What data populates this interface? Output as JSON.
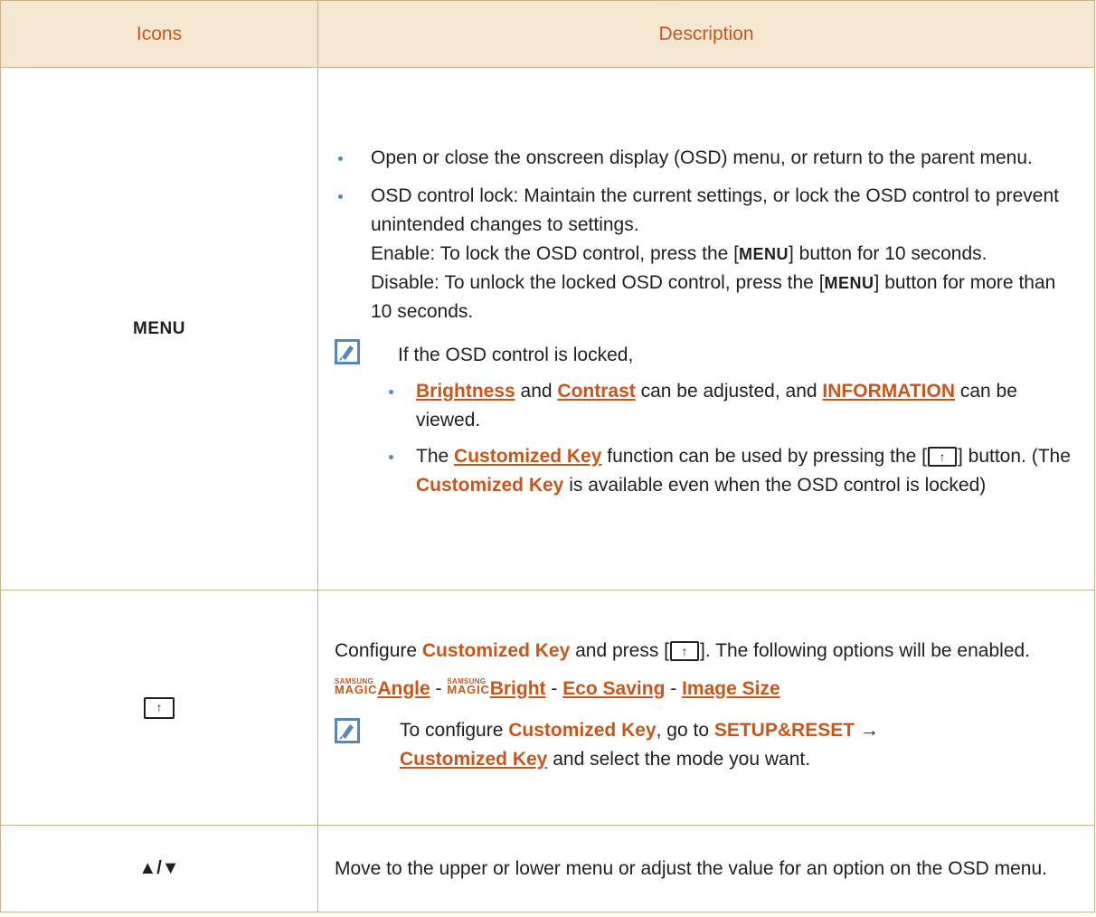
{
  "header": {
    "col_icons": "Icons",
    "col_description": "Description"
  },
  "row_menu": {
    "icon_label": "MENU",
    "bullet1": "Open or close the onscreen display (OSD) menu, or return to the parent menu.",
    "bullet2_line1": "OSD control lock: Maintain the current settings, or lock the OSD control to prevent unintended changes to settings.",
    "enable_pre": "Enable: To lock the OSD control, press the [",
    "enable_key": "MENU",
    "enable_post": "] button for 10 seconds.",
    "disable_pre": "Disable: To unlock the locked OSD control, press the [",
    "disable_key": "MENU",
    "disable_post": "] button for more than 10 seconds.",
    "note_intro": "If the OSD control is locked,",
    "sub1_a": "Brightness",
    "sub1_and": " and ",
    "sub1_b": "Contrast",
    "sub1_mid": " can be adjusted, and ",
    "sub1_c": "INFORMATION",
    "sub1_end": " can be viewed.",
    "sub2_pre": "The ",
    "sub2_link": "Customized Key",
    "sub2_mid": " function can be used by pressing the [",
    "sub2_post": "] button. (The ",
    "sub2_bold": "Customized Key",
    "sub2_end": " is available even when the OSD control is locked)"
  },
  "row_custom": {
    "icon_name": "customized-key-icon",
    "line_pre": "Configure ",
    "line_bold": "Customized Key",
    "line_mid": " and press [",
    "line_post": "]. The following options will be enabled.",
    "magic_top": "SAMSUNG",
    "magic_bottom": "MAGIC",
    "opt_angle": "Angle",
    "opt_bright": "Bright",
    "opt_eco": "Eco Saving",
    "opt_image": "Image Size",
    "separator": " - ",
    "note_pre": "To configure ",
    "note_bold1": "Customized Key",
    "note_mid": ", go to ",
    "note_bold2": "SETUP&RESET",
    "note_arrow": " →",
    "note_link": "Customized Key",
    "note_end": " and select the mode you want."
  },
  "row_updown": {
    "icon_label": "▲/▼",
    "desc": "Move to the upper or lower menu or adjust the value for an option on the OSD menu."
  }
}
